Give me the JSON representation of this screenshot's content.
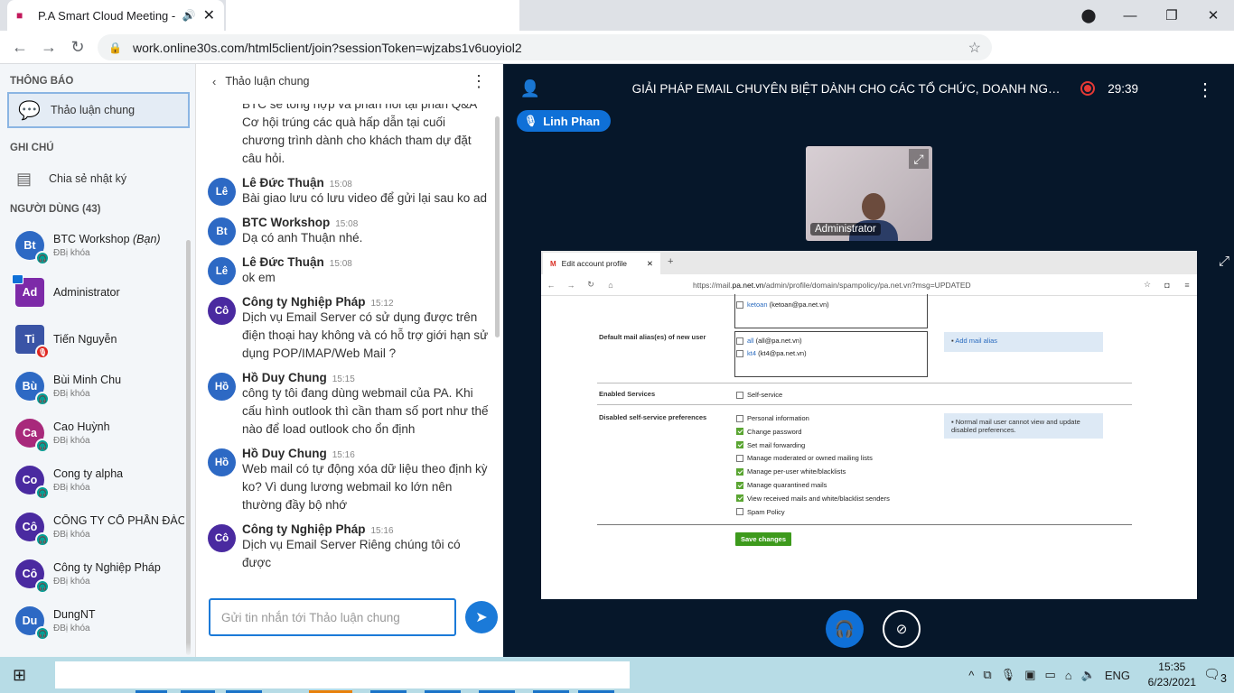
{
  "browser": {
    "tab_title": "P.A Smart Cloud Meeting - G",
    "url": "work.online30s.com/html5client/join?sessionToken=wjzabs1v6uoyiol2"
  },
  "sidebar": {
    "notifications_title": "THÔNG BÁO",
    "public_chat": "Thảo luận chung",
    "notes_title": "GHI CHÚ",
    "shared_notes": "Chia sẻ nhật ký",
    "users_title": "NGƯỜI DÙNG (43)",
    "users": [
      {
        "initials": "Bt",
        "name": "BTC Workshop",
        "you": "(Bạn)",
        "sub": "ĐBị khóa",
        "color": "#2d69c4"
      },
      {
        "initials": "Ad",
        "name": "Administrator",
        "sub": "",
        "color": "#7d2aa8"
      },
      {
        "initials": "Ti",
        "name": "Tiến Nguyễn",
        "sub": "",
        "color": "#3a54a6"
      },
      {
        "initials": "Bù",
        "name": "Bùi Minh Chu",
        "sub": "ĐBị khóa",
        "color": "#2d69c4"
      },
      {
        "initials": "Ca",
        "name": "Cao Huỳnh",
        "sub": "ĐBị khóa",
        "color": "#a8297b"
      },
      {
        "initials": "Co",
        "name": "Cong ty alpha",
        "sub": "ĐBị khóa",
        "color": "#4a2aa0"
      },
      {
        "initials": "Cô",
        "name": "CÔNG TY CỔ PHẦN ĐÀO T…",
        "sub": "ĐBị khóa",
        "color": "#4a2aa0"
      },
      {
        "initials": "Cô",
        "name": "Công ty Nghiệp Pháp",
        "sub": "ĐBị khóa",
        "color": "#4a2aa0"
      },
      {
        "initials": "Du",
        "name": "DungNT",
        "sub": "ĐBị khóa",
        "color": "#2d69c4"
      }
    ]
  },
  "chat": {
    "title": "Thảo luận chung",
    "intro_lines": [
      "BTC sẽ tổng hợp và phản hồi tại phần Q&A",
      "Cơ hội trúng các quà hấp dẫn tại cuối chương trình dành cho khách tham dự đặt câu hỏi."
    ],
    "messages": [
      {
        "initials": "Lê",
        "name": "Lê Đức Thuận",
        "time": "15:08",
        "text": "Bài giao lưu có lưu video để gửi lại sau ko ad",
        "color": "#2d69c4"
      },
      {
        "initials": "Bt",
        "name": "BTC Workshop",
        "time": "15:08",
        "text": "Dạ có anh Thuận nhé.",
        "color": "#2d69c4"
      },
      {
        "initials": "Lê",
        "name": "Lê Đức Thuận",
        "time": "15:08",
        "text": "ok em",
        "color": "#2d69c4"
      },
      {
        "initials": "Cô",
        "name": "Công ty Nghiệp Pháp",
        "time": "15:12",
        "text": "Dịch vụ Email Server có sử dụng được trên điện thoại hay không và có hỗ trợ giới hạn sử dụng POP/IMAP/Web Mail ?",
        "color": "#4a2aa0"
      },
      {
        "initials": "Hồ",
        "name": "Hồ Duy Chung",
        "time": "15:15",
        "text": "công ty tôi đang dùng webmail của PA. Khi cấu hình outlook thì cần tham số port như thế nào để load outlook cho ổn định",
        "color": "#2d69c4"
      },
      {
        "initials": "Hồ",
        "name": "Hồ Duy Chung",
        "time": "15:16",
        "text": "Web mail có tự động xóa dữ liệu theo định kỳ ko? Vì dung lương webmail ko lớn nên thường đầy bộ nhớ",
        "color": "#2d69c4"
      },
      {
        "initials": "Cô",
        "name": "Công ty Nghiệp Pháp",
        "time": "15:16",
        "text": "Dịch vụ Email Server Riêng chúng tôi có được",
        "color": "#4a2aa0"
      }
    ],
    "input_placeholder": "Gửi tin nhắn tới Thảo luận chung"
  },
  "stage": {
    "meeting_title": "GIẢI PHÁP EMAIL CHUYÊN BIỆT DÀNH CHO CÁC TỔ CHỨC, DOANH NG…",
    "timer": "29:39",
    "talking": "Linh Phan",
    "webcam_name": "Administrator"
  },
  "screenshare": {
    "tab_title": "Edit account profile",
    "url_prefix": "https://mail.",
    "url_domain": "pa.net.vn",
    "url_suffix": "/admin/profile/domain/spampolicy/pa.net.vn?msg=UPDATED",
    "alias_existing_link": "ketoan",
    "alias_existing_text": "(ketoan@pa.net.vn)",
    "default_alias_label": "Default mail alias(es) of new user",
    "alias_items": [
      {
        "link": "all",
        "text": "(all@pa.net.vn)"
      },
      {
        "link": "kt4",
        "text": "(kt4@pa.net.vn)"
      }
    ],
    "add_mail_alias": "Add mail alias",
    "enabled_services_label": "Enabled Services",
    "self_service": "Self-service",
    "disabled_prefs_label": "Disabled self-service preferences",
    "prefs": [
      {
        "label": "Personal information",
        "checked": false
      },
      {
        "label": "Change password",
        "checked": true
      },
      {
        "label": "Set mail forwarding",
        "checked": true
      },
      {
        "label": "Manage moderated or owned mailing lists",
        "checked": false
      },
      {
        "label": "Manage per-user white/blacklists",
        "checked": true
      },
      {
        "label": "Manage quarantined mails",
        "checked": true
      },
      {
        "label": "View received mails and white/blacklist senders",
        "checked": true
      },
      {
        "label": "Spam Policy",
        "checked": false
      }
    ],
    "prefs_note": "Normal mail user cannot view and update disabled preferences.",
    "save_button": "Save changes"
  },
  "taskbar": {
    "lang": "ENG",
    "time": "15:35",
    "date": "6/23/2021",
    "notifications": "3"
  }
}
